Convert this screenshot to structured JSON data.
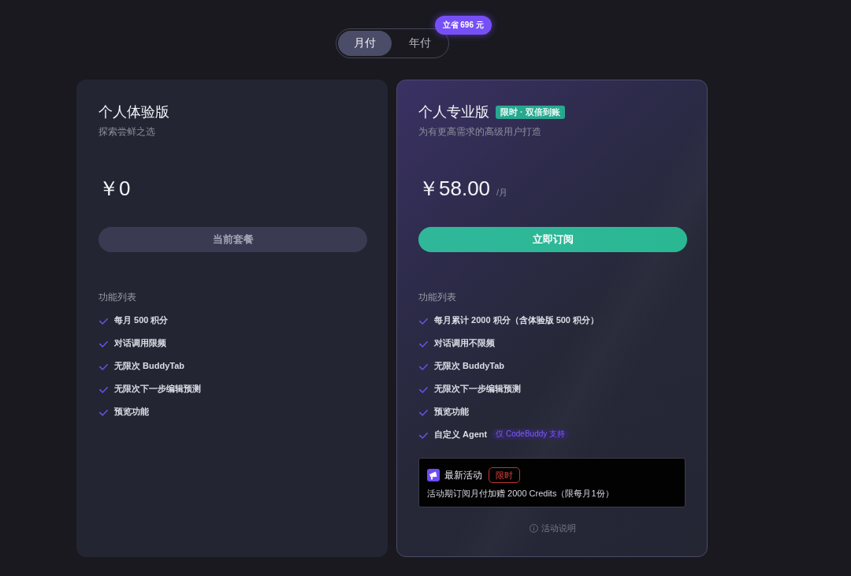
{
  "billing_toggle": {
    "options": [
      {
        "label": "月付",
        "selected": true
      },
      {
        "label": "年付",
        "selected": false
      }
    ],
    "savings_badge": "立省 696 元"
  },
  "plans": [
    {
      "name": "个人体验版",
      "subtitle": "探索尝鲜之选",
      "price": "￥0",
      "highlighted": false,
      "button": {
        "label": "当前套餐",
        "disabled": true
      },
      "features_title": "功能列表",
      "features": [
        {
          "text": "每月 500 积分"
        },
        {
          "text": "对话调用限频"
        },
        {
          "text": "无限次 BuddyTab"
        },
        {
          "text": "无限次下一步编辑预测"
        },
        {
          "text": "预览功能"
        }
      ]
    },
    {
      "name": "个人专业版",
      "tag": "限时 · 双倍到账",
      "subtitle": "为有更高需求的高级用户打造",
      "price": "￥58.00",
      "period": "/月",
      "highlighted": true,
      "button": {
        "label": "立即订阅",
        "disabled": false
      },
      "features_title": "功能列表",
      "features": [
        {
          "text": "每月累计 2000 积分（含体验版 500 积分）"
        },
        {
          "text": "对话调用不限频"
        },
        {
          "text": "无限次 BuddyTab"
        },
        {
          "text": "无限次下一步编辑预测"
        },
        {
          "text": "预览功能"
        },
        {
          "text": "自定义 Agent",
          "badge": "仅 CodeBuddy 支持"
        }
      ],
      "promo": {
        "title": "最新活动",
        "tag": "限时",
        "text": "活动期订阅月付加赠 2000 Credits（限每月1份）"
      },
      "info_link": "活动说明"
    }
  ]
}
